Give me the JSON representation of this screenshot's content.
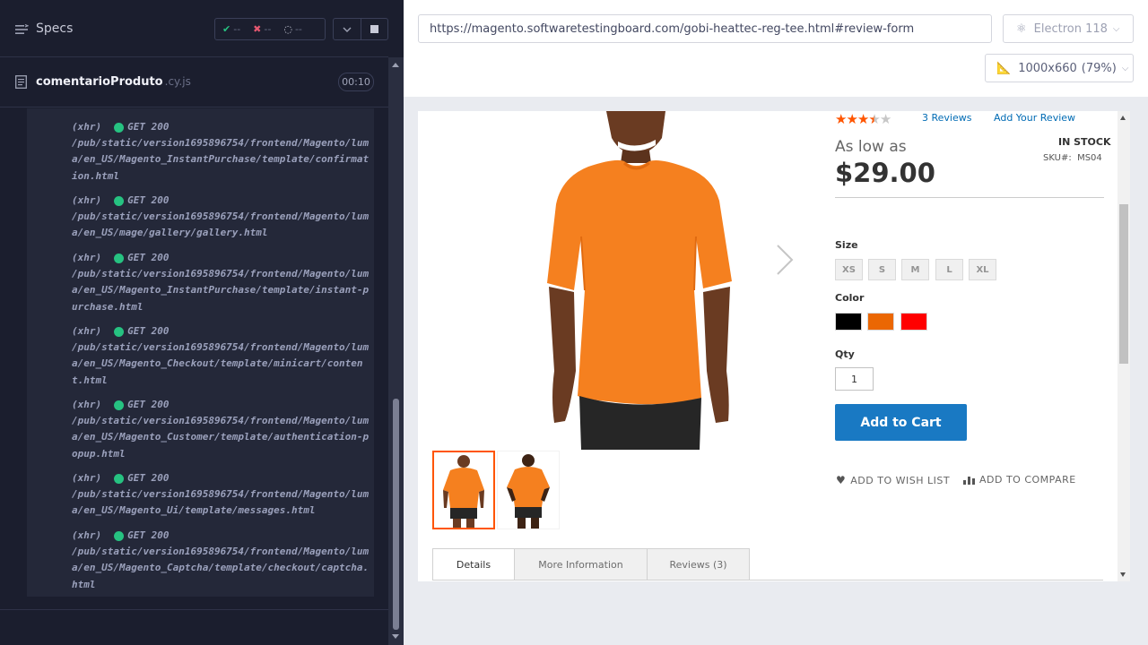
{
  "runner": {
    "specs_label": "Specs",
    "stats": {
      "passed": "--",
      "failed": "--",
      "pending": "--"
    },
    "spec_file": {
      "name": "comentarioProduto",
      "ext": ".cy.js",
      "duration": "00:10"
    },
    "log": [
      {
        "type": "(xhr)",
        "method": "GET 200",
        "path": "/pub/static/version1695896754/frontend/Magento/luma/en_US/Magento_InstantPurchase/template/confirmation.html"
      },
      {
        "type": "(xhr)",
        "method": "GET 200",
        "path": "/pub/static/version1695896754/frontend/Magento/luma/en_US/mage/gallery/gallery.html"
      },
      {
        "type": "(xhr)",
        "method": "GET 200",
        "path": "/pub/static/version1695896754/frontend/Magento/luma/en_US/Magento_InstantPurchase/template/instant-purchase.html"
      },
      {
        "type": "(xhr)",
        "method": "GET 200",
        "path": "/pub/static/version1695896754/frontend/Magento/luma/en_US/Magento_Checkout/template/minicart/content.html"
      },
      {
        "type": "(xhr)",
        "method": "GET 200",
        "path": "/pub/static/version1695896754/frontend/Magento/luma/en_US/Magento_Customer/template/authentication-popup.html"
      },
      {
        "type": "(xhr)",
        "method": "GET 200",
        "path": "/pub/static/version1695896754/frontend/Magento/luma/en_US/Magento_Ui/template/messages.html"
      },
      {
        "type": "(xhr)",
        "method": "GET 200",
        "path": "/pub/static/version1695896754/frontend/Magento/luma/en_US/Magento_Captcha/template/checkout/captcha.html"
      }
    ]
  },
  "browser": {
    "url": "https://magento.softwaretestingboard.com/gobi-heattec-reg-tee.html#review-form",
    "browser_name": "Electron 118",
    "viewport": "1000x660",
    "zoom": "(79%)"
  },
  "product": {
    "rating_stars": 3.5,
    "reviews_link": "3  Reviews",
    "add_review": "Add Your Review",
    "price_prefix": "As low as",
    "price": "$29.00",
    "stock": "IN STOCK",
    "sku_label": "SKU#:",
    "sku": "MS04",
    "size_label": "Size",
    "sizes": [
      "XS",
      "S",
      "M",
      "L",
      "XL"
    ],
    "color_label": "Color",
    "colors": [
      "#000000",
      "#eb6703",
      "#ff0000"
    ],
    "qty_label": "Qty",
    "qty": "1",
    "add_to_cart": "Add to Cart",
    "wishlist": "ADD TO WISH LIST",
    "compare": "ADD TO COMPARE",
    "tabs": [
      "Details",
      "More Information",
      "Reviews (3)"
    ],
    "shirt_color": "#f5801f"
  }
}
